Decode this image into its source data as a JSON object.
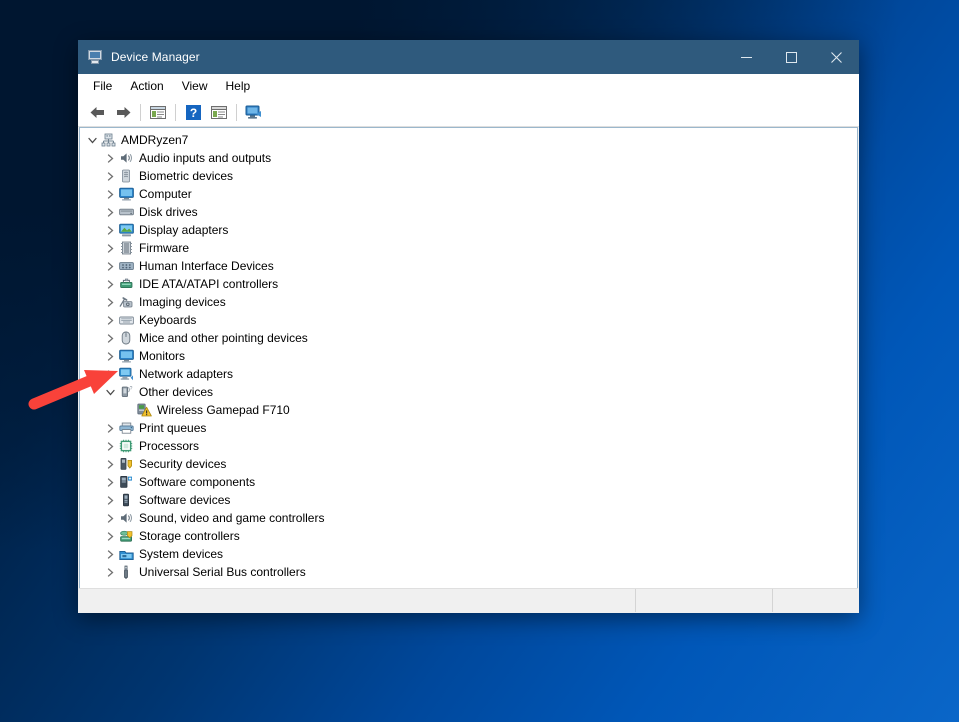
{
  "desktop": {
    "background_top_color": "#001834",
    "background_bottom_color": "#0a66c8"
  },
  "window": {
    "title": "Device Manager",
    "title_icon": "device-manager-icon",
    "titlebar_color": "#2f5a7d",
    "controls": {
      "minimize": "Minimize",
      "maximize": "Maximize",
      "close": "Close"
    }
  },
  "menubar": {
    "items": [
      {
        "label": "File"
      },
      {
        "label": "Action"
      },
      {
        "label": "View"
      },
      {
        "label": "Help"
      }
    ]
  },
  "toolbar": {
    "buttons": [
      {
        "name": "back-arrow-icon",
        "tooltip": "Back"
      },
      {
        "name": "forward-arrow-icon",
        "tooltip": "Forward"
      },
      {
        "name": "show-hide-console-tree-icon",
        "tooltip": "Show/Hide Console Tree"
      },
      {
        "name": "help-icon",
        "tooltip": "Help"
      },
      {
        "name": "properties-icon",
        "tooltip": "Properties"
      },
      {
        "name": "scan-for-hardware-changes-icon",
        "tooltip": "Scan for hardware changes"
      }
    ]
  },
  "tree": {
    "root": {
      "label": "AMDRyzen7",
      "icon": "computer-node-icon",
      "expanded": true,
      "level": 0
    },
    "nodes": [
      {
        "label": "Audio inputs and outputs",
        "icon": "speaker-icon",
        "expanded": false,
        "level": 1,
        "has_children": true,
        "warning": false
      },
      {
        "label": "Biometric devices",
        "icon": "fingerprint-icon",
        "expanded": false,
        "level": 1,
        "has_children": true,
        "warning": false
      },
      {
        "label": "Computer",
        "icon": "monitor-icon",
        "expanded": false,
        "level": 1,
        "has_children": true,
        "warning": false
      },
      {
        "label": "Disk drives",
        "icon": "disk-drive-icon",
        "expanded": false,
        "level": 1,
        "has_children": true,
        "warning": false
      },
      {
        "label": "Display adapters",
        "icon": "display-adapter-icon",
        "expanded": false,
        "level": 1,
        "has_children": true,
        "warning": false
      },
      {
        "label": "Firmware",
        "icon": "firmware-chip-icon",
        "expanded": false,
        "level": 1,
        "has_children": true,
        "warning": false
      },
      {
        "label": "Human Interface Devices",
        "icon": "hid-icon",
        "expanded": false,
        "level": 1,
        "has_children": true,
        "warning": false
      },
      {
        "label": "IDE ATA/ATAPI controllers",
        "icon": "ide-controller-icon",
        "expanded": false,
        "level": 1,
        "has_children": true,
        "warning": false
      },
      {
        "label": "Imaging devices",
        "icon": "camera-icon",
        "expanded": false,
        "level": 1,
        "has_children": true,
        "warning": false
      },
      {
        "label": "Keyboards",
        "icon": "keyboard-icon",
        "expanded": false,
        "level": 1,
        "has_children": true,
        "warning": false
      },
      {
        "label": "Mice and other pointing devices",
        "icon": "mouse-icon",
        "expanded": false,
        "level": 1,
        "has_children": true,
        "warning": false
      },
      {
        "label": "Monitors",
        "icon": "monitor-icon",
        "expanded": false,
        "level": 1,
        "has_children": true,
        "warning": false
      },
      {
        "label": "Network adapters",
        "icon": "network-adapter-icon",
        "expanded": false,
        "level": 1,
        "has_children": true,
        "warning": false
      },
      {
        "label": "Other devices",
        "icon": "other-device-icon",
        "expanded": true,
        "level": 1,
        "has_children": true,
        "warning": false
      },
      {
        "label": "Wireless Gamepad F710",
        "icon": "unknown-device-warning-icon",
        "expanded": false,
        "level": 2,
        "has_children": false,
        "warning": true
      },
      {
        "label": "Print queues",
        "icon": "printer-icon",
        "expanded": false,
        "level": 1,
        "has_children": true,
        "warning": false
      },
      {
        "label": "Processors",
        "icon": "processor-icon",
        "expanded": false,
        "level": 1,
        "has_children": true,
        "warning": false
      },
      {
        "label": "Security devices",
        "icon": "security-device-icon",
        "expanded": false,
        "level": 1,
        "has_children": true,
        "warning": false
      },
      {
        "label": "Software components",
        "icon": "software-component-icon",
        "expanded": false,
        "level": 1,
        "has_children": true,
        "warning": false
      },
      {
        "label": "Software devices",
        "icon": "software-device-icon",
        "expanded": false,
        "level": 1,
        "has_children": true,
        "warning": false
      },
      {
        "label": "Sound, video and game controllers",
        "icon": "speaker-icon",
        "expanded": false,
        "level": 1,
        "has_children": true,
        "warning": false
      },
      {
        "label": "Storage controllers",
        "icon": "storage-controller-icon",
        "expanded": false,
        "level": 1,
        "has_children": true,
        "warning": false
      },
      {
        "label": "System devices",
        "icon": "system-device-icon",
        "expanded": false,
        "level": 1,
        "has_children": true,
        "warning": false
      },
      {
        "label": "Universal Serial Bus controllers",
        "icon": "usb-icon",
        "expanded": false,
        "level": 1,
        "has_children": true,
        "warning": false
      }
    ]
  },
  "statusbar": {
    "panes": [
      "",
      "",
      ""
    ]
  },
  "annotation": {
    "arrow_color": "#f9423a",
    "points_at": "Other devices"
  }
}
